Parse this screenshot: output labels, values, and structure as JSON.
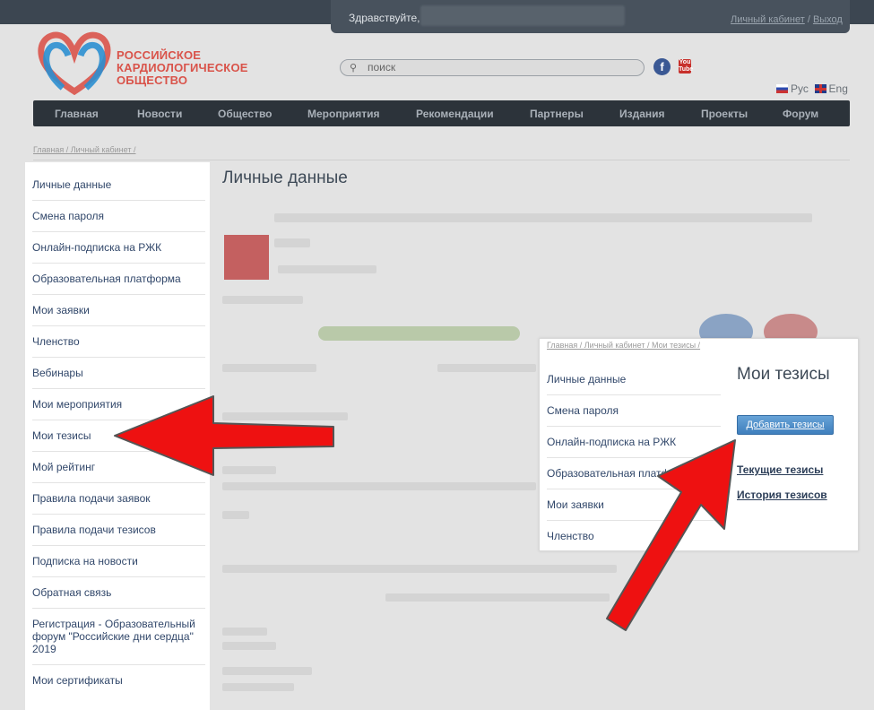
{
  "header": {
    "greeting": "Здравствуйте,",
    "account_link": "Личный кабинет",
    "separator": " / ",
    "logout_link": "Выход",
    "logo_line1": "РОССИЙСКОЕ",
    "logo_line2": "КАРДИОЛОГИЧЕСКОЕ",
    "logo_line3": "ОБЩЕСТВО",
    "search_placeholder": "поиск",
    "facebook": "f",
    "youtube": "You Tube",
    "lang_ru": "Рус",
    "lang_en": "Eng"
  },
  "nav": [
    "Главная",
    "Новости",
    "Общество",
    "Мероприятия",
    "Рекомендации",
    "Партнеры",
    "Издания",
    "Проекты",
    "Форум"
  ],
  "breadcrumb": "Главная / Личный кабинет /",
  "page_title": "Личные данные",
  "sidebar": {
    "items": [
      "Личные данные",
      "Смена пароля",
      "Онлайн-подписка на РЖК",
      "Образовательная платформа",
      "Мои заявки",
      "Членство",
      "Вебинары",
      "Мои мероприятия",
      "Мои тезисы",
      "Мой рейтинг",
      "Правила подачи заявок",
      "Правила подачи тезисов",
      "Подписка на новости",
      "Обратная связь",
      "Регистрация - Образовательный форум \"Российские дни сердца\" 2019",
      "Мои сертификаты"
    ]
  },
  "popup": {
    "breadcrumb": "Главная / Личный кабинет / Мои тезисы /",
    "items": [
      "Личные данные",
      "Смена пароля",
      "Онлайн-подписка на РЖК",
      "Образовательная платформа",
      "Мои заявки",
      "Членство"
    ],
    "title": "Мои тезисы",
    "add_button": "Добавить тезисы",
    "current_link": "Текущие тезисы",
    "history_link": "История тезисов"
  },
  "colors": {
    "arrow": "#ee1111",
    "nav_bg": "#2c333a",
    "brand_red": "#d9534a",
    "link_blue": "#31476a"
  }
}
